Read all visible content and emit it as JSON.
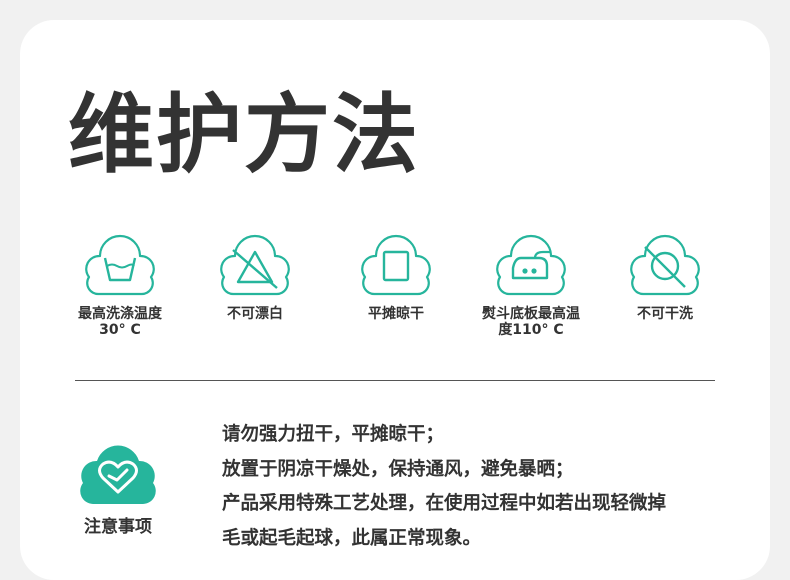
{
  "title": "维护方法",
  "care_items": [
    {
      "icon": "wash-30-icon",
      "label": "最高洗涤温度\n30° C"
    },
    {
      "icon": "no-bleach-icon",
      "label": "不可漂白"
    },
    {
      "icon": "dry-flat-icon",
      "label": "平摊晾干"
    },
    {
      "icon": "iron-icon",
      "label": "熨斗底板最高温\n度110° C"
    },
    {
      "icon": "no-dry-clean-icon",
      "label": "不可干洗"
    }
  ],
  "notice": {
    "icon": "heart-cloud-icon",
    "title": "注意事项",
    "lines": [
      "请勿强力扭干，平摊晾干；",
      "放置于阴凉干燥处，保持通风，避免暴晒；",
      "产品采用特殊工艺处理，在使用过程中如若出现轻微掉",
      "毛或起毛起球，此属正常现象。"
    ]
  },
  "colors": {
    "accent": "#26b59c",
    "text": "#333333",
    "background": "#f1f1f1",
    "card": "#ffffff"
  }
}
